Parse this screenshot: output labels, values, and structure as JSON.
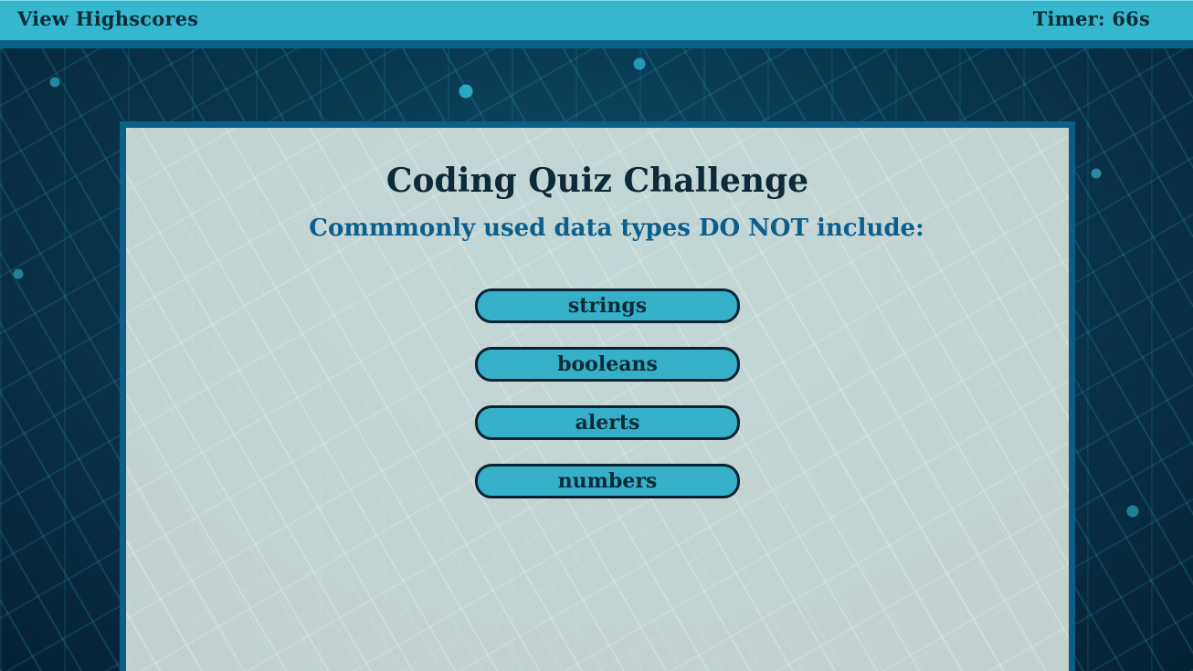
{
  "header": {
    "highscores_label": "View Highscores",
    "timer_text": "Timer: 66s"
  },
  "quiz": {
    "title": "Coding Quiz Challenge",
    "question": "Commmonly used data types DO NOT include:",
    "answers": [
      {
        "label": "strings"
      },
      {
        "label": "booleans"
      },
      {
        "label": "alerts"
      },
      {
        "label": "numbers"
      }
    ]
  },
  "colors": {
    "header_bg": "#35b8cf",
    "header_border": "#0b5e86",
    "question_text": "#0c5f8c",
    "button_bg": "#35b0c8",
    "button_border": "#0b2231"
  }
}
